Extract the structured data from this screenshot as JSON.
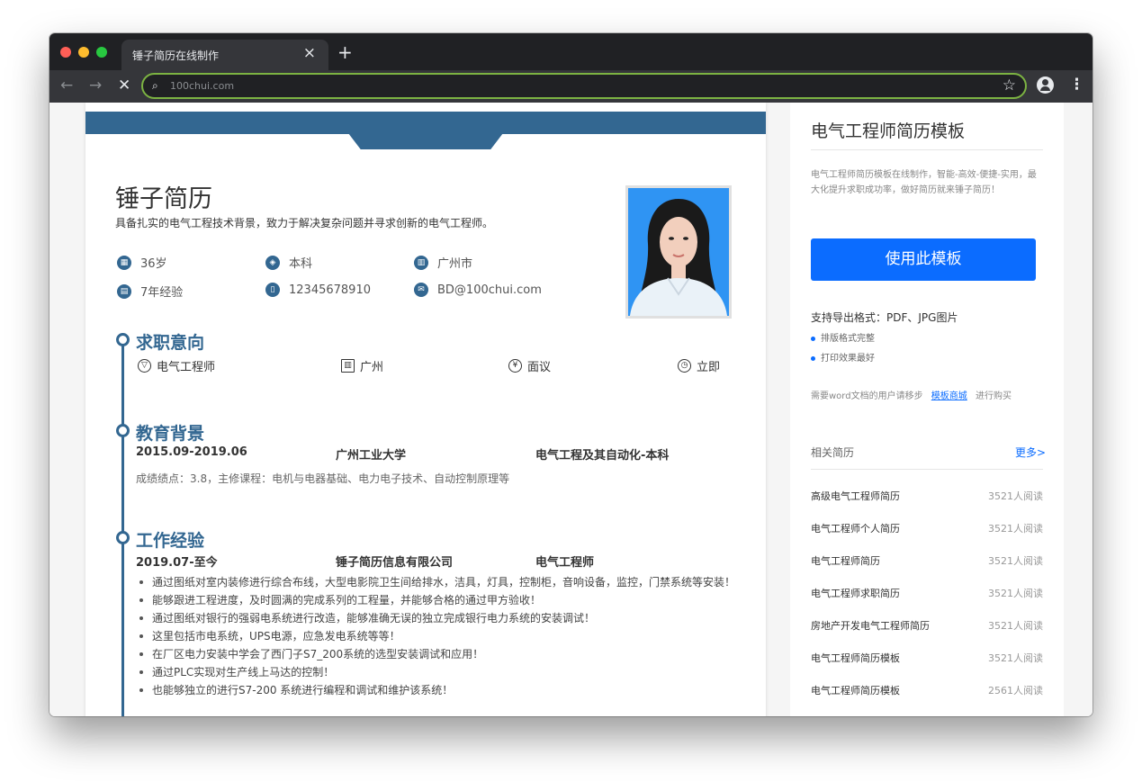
{
  "browser": {
    "tab_title": "锤子简历在线制作",
    "tab_close": "×",
    "new_tab": "+",
    "url": "100chui.com",
    "back_icon": "←",
    "forward_icon": "→",
    "stop_icon": "✕",
    "search_icon": "⌕",
    "star_icon": "☆",
    "menu_icon": "⋮",
    "dot_colors": [
      "#ff5f57",
      "#febc2e",
      "#28c840"
    ]
  },
  "resume": {
    "name": "锤子简历",
    "motto": "具备扎实的电气工程技术背景，致力于解决复杂问题并寻求创新的电气工程师。",
    "info": [
      {
        "icon": "calendar-icon",
        "text": "36岁"
      },
      {
        "icon": "graduation-icon",
        "text": "本科"
      },
      {
        "icon": "building-icon",
        "text": "广州市"
      },
      {
        "icon": "briefcase-icon",
        "text": "7年经验"
      },
      {
        "icon": "phone-icon",
        "text": "12345678910"
      },
      {
        "icon": "mail-icon",
        "text": "BD@100chui.com"
      }
    ],
    "intent": {
      "title": "求职意向",
      "items": [
        {
          "icon": "tie-icon",
          "text": "电气工程师"
        },
        {
          "icon": "city-icon",
          "text": "广州"
        },
        {
          "icon": "yen-icon",
          "text": "面议"
        },
        {
          "icon": "clock-icon",
          "text": "立即"
        }
      ]
    },
    "education": {
      "title": "教育背景",
      "date": "2015.09-2019.06",
      "school": "广州工业大学",
      "major": "电气工程及其自动化-本科",
      "desc": "成绩绩点：3.8，主修课程：电机与电器基础、电力电子技术、自动控制原理等"
    },
    "work": {
      "title": "工作经验",
      "date": "2019.07-至今",
      "company": "锤子简历信息有限公司",
      "position": "电气工程师",
      "bullets": [
        "通过图纸对室内装修进行综合布线，大型电影院卫生间给排水，洁具，灯具，控制柜，音响设备，监控，门禁系统等安装！",
        "能够跟进工程进度，及时圆满的完成系列的工程量，并能够合格的通过甲方验收！",
        "通过图纸对银行的强弱电系统进行改造，能够准确无误的独立完成银行电力系统的安装调试！",
        "这里包括市电系统，UPS电源，应急发电系统等等！",
        "在厂区电力安装中学会了西门子S7_200系统的选型安装调试和应用！",
        "通过PLC实现对生产线上马达的控制！",
        "也能够独立的进行S7-200 系统进行编程和调试和维护该系统！"
      ]
    }
  },
  "sidebar": {
    "title": "电气工程师简历模板",
    "desc": "电气工程师简历模板在线制作，智能-高效-便捷-实用，最大化提升求职成功率，做好简历就来锤子简历！",
    "use_button": "使用此模板",
    "support": "支持导出格式：PDF、JPG图片",
    "features": [
      "排版格式完整",
      "打印效果最好"
    ],
    "word_prefix": "需要word文档的用户请移步",
    "word_link": "模板商城",
    "word_suffix": "进行购买",
    "related_title": "相关简历",
    "related_more": "更多>",
    "related": [
      {
        "name": "高级电气工程师简历",
        "count": "3521人阅读"
      },
      {
        "name": "电气工程师个人简历",
        "count": "3521人阅读"
      },
      {
        "name": "电气工程师简历",
        "count": "3521人阅读"
      },
      {
        "name": "电气工程师求职简历",
        "count": "3521人阅读"
      },
      {
        "name": "房地产开发电气工程师简历",
        "count": "3521人阅读"
      },
      {
        "name": "电气工程师简历模板",
        "count": "3521人阅读"
      },
      {
        "name": "电气工程师简历模板",
        "count": "2561人阅读"
      }
    ]
  },
  "colors": {
    "accent": "#336791",
    "button": "#0b6cff",
    "omnibox_border": "#7cb342"
  }
}
